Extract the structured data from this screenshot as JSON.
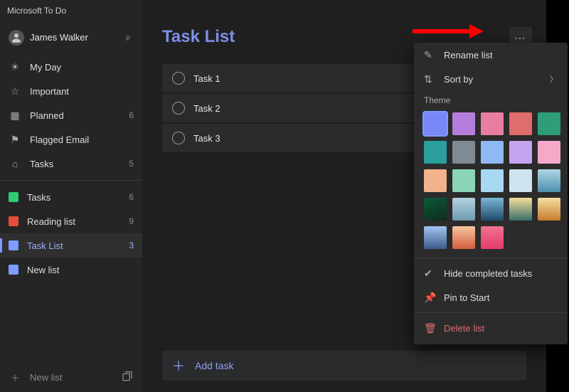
{
  "titlebar": {
    "app_name": "Microsoft To Do"
  },
  "profile": {
    "name": "James Walker"
  },
  "nav": [
    {
      "icon": "☀",
      "label": "My Day",
      "count": ""
    },
    {
      "icon": "☆",
      "label": "Important",
      "count": ""
    },
    {
      "icon": "▦",
      "label": "Planned",
      "count": "6"
    },
    {
      "icon": "⚑",
      "label": "Flagged Email",
      "count": ""
    },
    {
      "icon": "⌂",
      "label": "Tasks",
      "count": "5"
    }
  ],
  "lists": [
    {
      "color": "#2ecc71",
      "label": "Tasks",
      "count": "6",
      "active": false
    },
    {
      "color": "#e74c3c",
      "label": "Reading list",
      "count": "9",
      "active": false
    },
    {
      "color": "#7e9cff",
      "label": "Task List",
      "count": "3",
      "active": true
    },
    {
      "color": "#7e9cff",
      "label": "New list",
      "count": "",
      "active": false
    }
  ],
  "new_list_label": "New list",
  "main": {
    "title": "Task List",
    "tasks": [
      {
        "label": "Task 1"
      },
      {
        "label": "Task 2"
      },
      {
        "label": "Task 3"
      }
    ],
    "add_task_label": "Add task"
  },
  "menu": {
    "rename": "Rename list",
    "sort": "Sort by",
    "theme_header": "Theme",
    "swatches": [
      {
        "bg": "#7986f7",
        "selected": true
      },
      {
        "bg": "#b57edc"
      },
      {
        "bg": "#e77ea0"
      },
      {
        "bg": "#e06c6c"
      },
      {
        "bg": "#2e9e7a"
      },
      {
        "bg": "#2b9e9e"
      },
      {
        "bg": "#808a93"
      },
      {
        "bg": "#8fb9f5"
      },
      {
        "bg": "#c6a5f0"
      },
      {
        "bg": "#f3a9c7"
      },
      {
        "bg": "#f2b28c"
      },
      {
        "bg": "#8ad5b5"
      },
      {
        "bg": "#a7d9f2"
      },
      {
        "bg": "#cfe3ef"
      },
      {
        "bg": "linear-gradient(#afd6e6,#4d8fae)"
      },
      {
        "bg": "linear-gradient(160deg,#0b5b3b,#0e2b1b)"
      },
      {
        "bg": "linear-gradient(#b5d3df,#6e9ab0)"
      },
      {
        "bg": "linear-gradient(#7bb7d6,#1f496b)"
      },
      {
        "bg": "linear-gradient(#f5df9c,#3a6f6a)"
      },
      {
        "bg": "linear-gradient(#f4e0a1,#c77b2d)"
      },
      {
        "bg": "linear-gradient(#a3c5ef,#3b5a8a)"
      },
      {
        "bg": "linear-gradient(#f6c89f,#d45b3c)"
      },
      {
        "bg": "linear-gradient(#f0748f,#e43a6a)"
      }
    ],
    "hide_completed": "Hide completed tasks",
    "pin": "Pin to Start",
    "delete": "Delete list"
  }
}
